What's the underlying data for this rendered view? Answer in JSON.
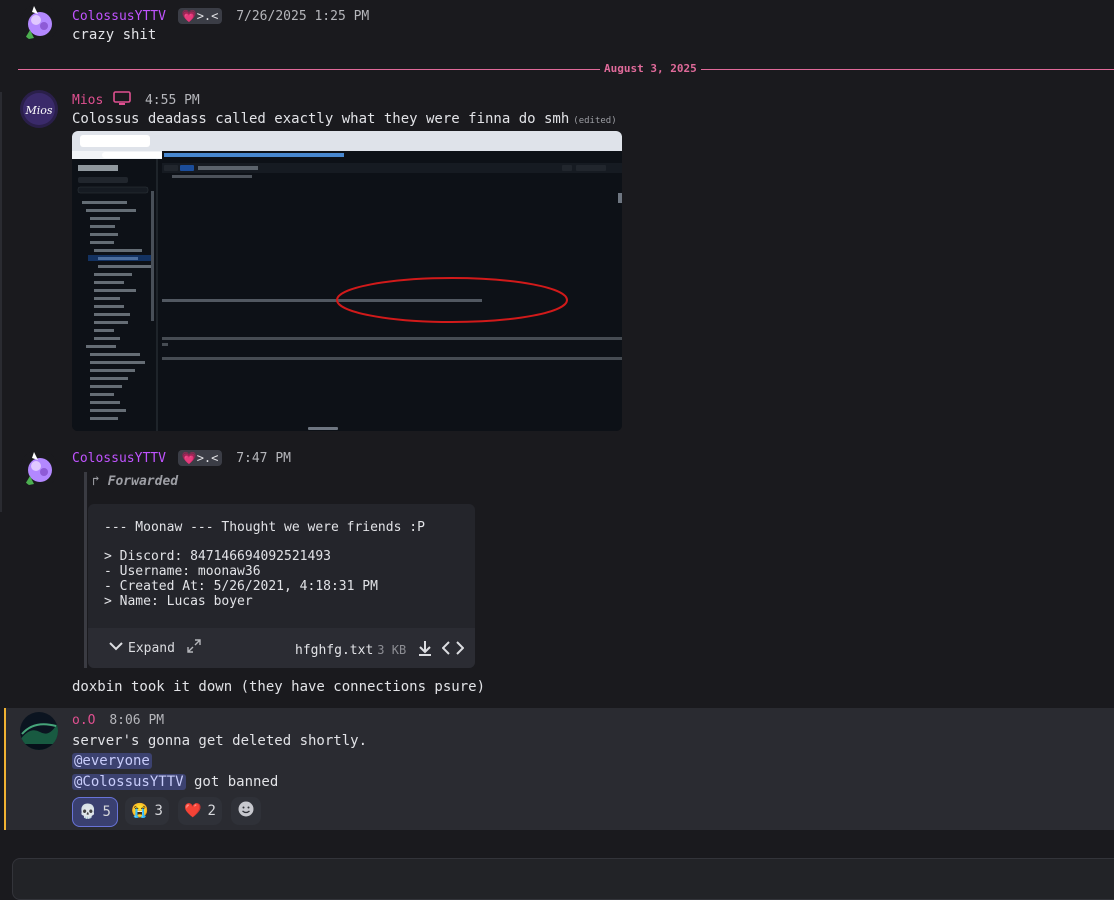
{
  "messages": {
    "m1": {
      "author": "ColossusYTTV",
      "badge": "💗>.<",
      "timestamp": "7/26/2025 1:25 PM",
      "text": "crazy shit"
    },
    "divider": {
      "label": "August 3, 2025"
    },
    "m2": {
      "author": "Mios",
      "timestamp": "4:55 PM",
      "text": "Colossus deadass called exactly what they were finna do smh",
      "edited": "(edited)"
    },
    "m3": {
      "author": "ColossusYTTV",
      "badge": "💗>.<",
      "timestamp": "7:47 PM",
      "forwarded_label": "Forwarded",
      "file_lines": [
        "--- Moonaw --- Thought we were friends :P",
        "",
        "> Discord: 847146694092521493",
        "- Username: moonaw36",
        "- Created At: 5/26/2021, 4:18:31 PM",
        "> Name: Lucas boyer"
      ],
      "expand_label": "Expand",
      "file_name": "hfghfg.txt",
      "file_size": "3 KB",
      "text": "doxbin took it down (they have connections psure)"
    },
    "m4": {
      "author": "o.O",
      "timestamp": "8:06 PM",
      "line1": "server's gonna get deleted shortly.",
      "mention1": "@everyone",
      "mention2": "@ColossusYTTV",
      "line3_suffix": " got banned",
      "reactions": [
        {
          "emoji": "💀",
          "count": "5"
        },
        {
          "emoji": "😭",
          "count": "3"
        },
        {
          "emoji": "❤️",
          "count": "2"
        }
      ]
    }
  },
  "colors": {
    "accent_pink": "#e06a9a",
    "name_purple": "#c053ff",
    "mention_bg": "#3c4270",
    "highlight_bar": "#f0b232"
  }
}
